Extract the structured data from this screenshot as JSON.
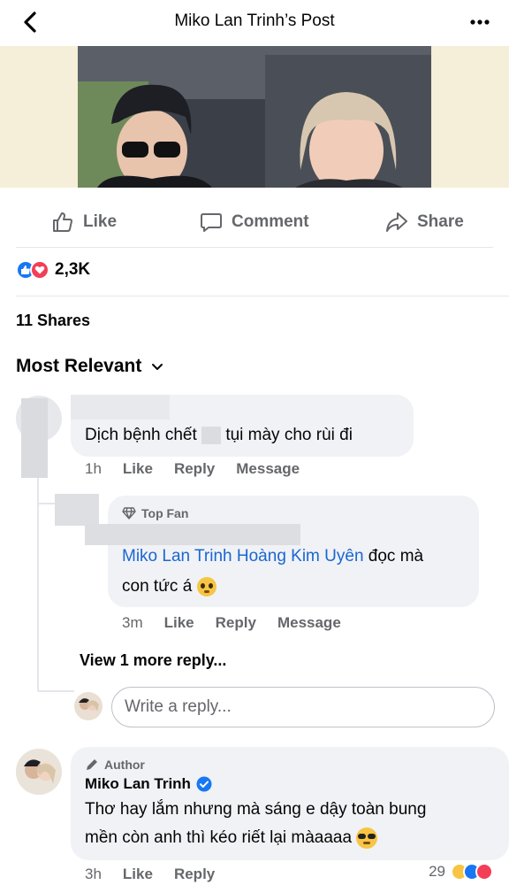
{
  "header": {
    "title": "Miko Lan Trinh’s Post"
  },
  "actions": {
    "like": "Like",
    "comment": "Comment",
    "share": "Share"
  },
  "reactions": {
    "count": "2,3K"
  },
  "shares": "11 Shares",
  "sort": "Most Relevant",
  "comments": [
    {
      "text": "Dịch bệnh chết ... tụi mày cho rùi đi",
      "text_before": "Dịch bệnh chết",
      "text_after": "tụi mày cho rùi đi",
      "time": "1h",
      "like": "Like",
      "reply": "Reply",
      "message": "Message"
    },
    {
      "badge": "Top Fan",
      "mention": "Miko Lan Trinh Hoàng Kim Uyên",
      "text_line1_rest": "đọc mà",
      "text_line2": "con tức á",
      "time": "3m",
      "like": "Like",
      "reply": "Reply",
      "message": "Message"
    },
    {
      "badge": "Author",
      "name": "Miko Lan Trinh",
      "line1": "Thơ hay lắm nhưng mà sáng e dậy toàn bung",
      "line2": "mền còn anh thì kéo riết lại màaaaa",
      "time": "3h",
      "like": "Like",
      "reply": "Reply",
      "reaction_count": "29"
    }
  ],
  "view_more": "View 1 more reply...",
  "reply_placeholder": "Write a reply...",
  "colors": {
    "link": "#1b66d2",
    "like_blue": "#1877f2",
    "love_red": "#f33e58",
    "bubble": "#f0f2f5"
  },
  "icons": [
    "chevron-left-icon",
    "more-icon",
    "thumbs-up-icon",
    "comment-icon",
    "share-icon",
    "diamond-icon",
    "pen-icon",
    "verified-icon"
  ]
}
